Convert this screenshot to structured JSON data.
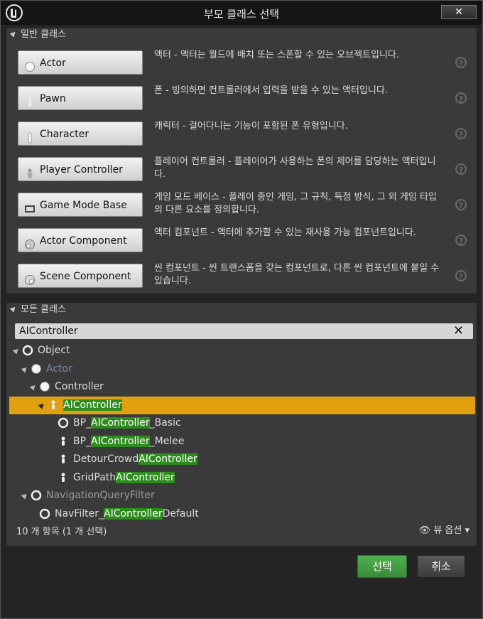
{
  "window": {
    "title": "부모 클래스 선택",
    "close_glyph": "✕"
  },
  "common": {
    "header": "일반 클래스",
    "items": [
      {
        "label": "Actor",
        "desc": "액터 - 액터는 월드에 배치 또는 스폰할 수 있는 오브젝트입니다.",
        "icon": "actor-icon"
      },
      {
        "label": "Pawn",
        "desc": "폰 - 빙의하면 컨트롤러에서 입력을 받을 수 있는 액터입니다.",
        "icon": "pawn-icon"
      },
      {
        "label": "Character",
        "desc": "캐릭터 - 걸어다니는 기능이 포함된 폰 유형입니다.",
        "icon": "character-icon"
      },
      {
        "label": "Player Controller",
        "desc": "플레이어 컨트롤러 - 플레이어가 사용하는 폰의 제어를 담당하는 액터입니다.",
        "icon": "player-controller-icon"
      },
      {
        "label": "Game Mode Base",
        "desc": "게임 모드 베이스 - 플레이 중인 게임, 그 규칙, 득점 방식, 그 외 게임 타입의 다른 요소를 정의합니다.",
        "icon": "game-mode-icon"
      },
      {
        "label": "Actor Component",
        "desc": "액터 컴포넌트 - 액터에 추가할 수 있는 재사용 가능 컴포넌트입니다.",
        "icon": "actor-component-icon"
      },
      {
        "label": "Scene Component",
        "desc": "씬 컴포넌트 - 씬 트랜스폼을 갖는 컴포넌트로, 다른 씬 컴포넌트에 붙일 수 있습니다.",
        "icon": "scene-component-icon"
      }
    ]
  },
  "all": {
    "header": "모든 클래스",
    "search_value": "AIController",
    "tree": [
      {
        "pre": "Object",
        "hl": "",
        "post": "",
        "icon": "object-icon",
        "expanded": true
      },
      {
        "pre": "Actor",
        "hl": "",
        "post": "",
        "icon": "actor-icon",
        "expanded": true,
        "dim": true
      },
      {
        "pre": "Controller",
        "hl": "",
        "post": "",
        "icon": "actor-icon",
        "expanded": true
      },
      {
        "pre": "",
        "hl": "AIController",
        "post": "",
        "icon": "pawn-icon",
        "expanded": true,
        "selected": true
      },
      {
        "pre": "BP_",
        "hl": "AIController",
        "post": "_Basic",
        "icon": "object-icon"
      },
      {
        "pre": "BP_",
        "hl": "AIController",
        "post": "_Melee",
        "icon": "pawn-icon"
      },
      {
        "pre": "DetourCrowd",
        "hl": "AIController",
        "post": "",
        "icon": "pawn-icon"
      },
      {
        "pre": "GridPath",
        "hl": "AIController",
        "post": "",
        "icon": "pawn-icon"
      },
      {
        "pre": "NavigationQueryFilter",
        "hl": "",
        "post": "",
        "icon": "object-icon",
        "expanded": true,
        "dim2": true
      },
      {
        "pre": "NavFilter_",
        "hl": "AIController",
        "post": "Default",
        "icon": "object-icon"
      }
    ],
    "count_text": "10 개 항목 (1 개 선택)",
    "view_options": "뷰 옵션"
  },
  "buttons": {
    "select": "선택",
    "cancel": "취소"
  },
  "colors": {
    "selected_row": "#e0a010",
    "highlight": "#2e8c1e",
    "select_button": "#3f9a3f"
  }
}
